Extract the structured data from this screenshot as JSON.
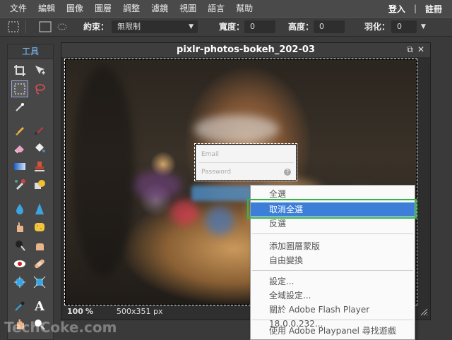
{
  "menubar": {
    "items": [
      "文件",
      "編輯",
      "圖像",
      "圖層",
      "調整",
      "濾鏡",
      "視圖",
      "語言",
      "幫助"
    ],
    "login": "登入",
    "separator": "|",
    "register": "註冊"
  },
  "options": {
    "constraint_label": "約束：",
    "constraint_value": "無限制",
    "width_label": "寬度：",
    "width_value": "0",
    "height_label": "高度：",
    "height_value": "0",
    "feather_label": "羽化：",
    "feather_value": "0"
  },
  "tools": {
    "title": "工具",
    "text_tool_glyph": "A"
  },
  "document": {
    "title": "pixlr-photos-bokeh_202-03",
    "zoom": "100",
    "zoom_unit": "%",
    "dimensions": "500x351 px"
  },
  "login_form": {
    "email_placeholder": "Email",
    "password_placeholder": "Password",
    "help_glyph": "?"
  },
  "context_menu": {
    "items": [
      "全選",
      "取消全選",
      "反選",
      "添加圖層蒙版",
      "自由變換",
      "設定...",
      "全域設定...",
      "關於 Adobe Flash Player 18.0.0.232...",
      "使用 Adobe Playpanel 尋找遊戲"
    ],
    "highlighted_index": 1
  },
  "watermark": "TechCoke.com",
  "colors": {
    "highlight": "#3d7ed9",
    "annotation": "#2fb84a",
    "tool_title": "#7fc4ff"
  }
}
